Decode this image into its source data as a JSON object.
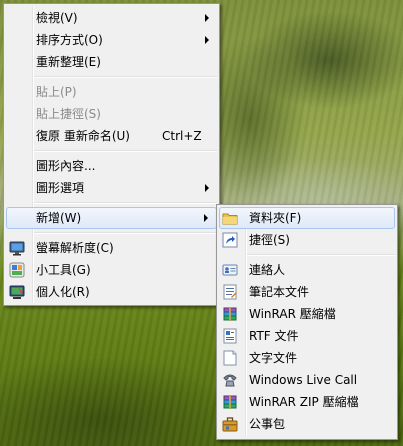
{
  "context_menu": {
    "items": [
      {
        "label": "檢視(V)"
      },
      {
        "label": "排序方式(O)"
      },
      {
        "label": "重新整理(E)"
      },
      {
        "label": "貼上(P)"
      },
      {
        "label": "貼上捷徑(S)"
      },
      {
        "label": "復原 重新命名(U)",
        "shortcut": "Ctrl+Z"
      },
      {
        "label": "圖形內容..."
      },
      {
        "label": "圖形選項"
      },
      {
        "label": "新增(W)"
      },
      {
        "label": "螢幕解析度(C)"
      },
      {
        "label": "小工具(G)"
      },
      {
        "label": "個人化(R)"
      }
    ]
  },
  "new_submenu": {
    "items": [
      {
        "label": "資料夾(F)",
        "icon": "folder-icon"
      },
      {
        "label": "捷徑(S)",
        "icon": "shortcut-icon"
      },
      {
        "label": "連絡人",
        "icon": "contact-icon"
      },
      {
        "label": "筆記本文件",
        "icon": "journal-document-icon"
      },
      {
        "label": "WinRAR 壓縮檔",
        "icon": "winrar-archive-icon"
      },
      {
        "label": "RTF 文件",
        "icon": "rtf-document-icon"
      },
      {
        "label": "文字文件",
        "icon": "text-document-icon"
      },
      {
        "label": "Windows Live Call",
        "icon": "phone-icon"
      },
      {
        "label": "WinRAR ZIP 壓縮檔",
        "icon": "winrar-zip-icon"
      },
      {
        "label": "公事包",
        "icon": "briefcase-icon"
      }
    ]
  },
  "colors": {
    "menu_bg": "#f0f0f0",
    "highlight_border": "#a8c6ee",
    "disabled_text": "#8a8a8a"
  }
}
